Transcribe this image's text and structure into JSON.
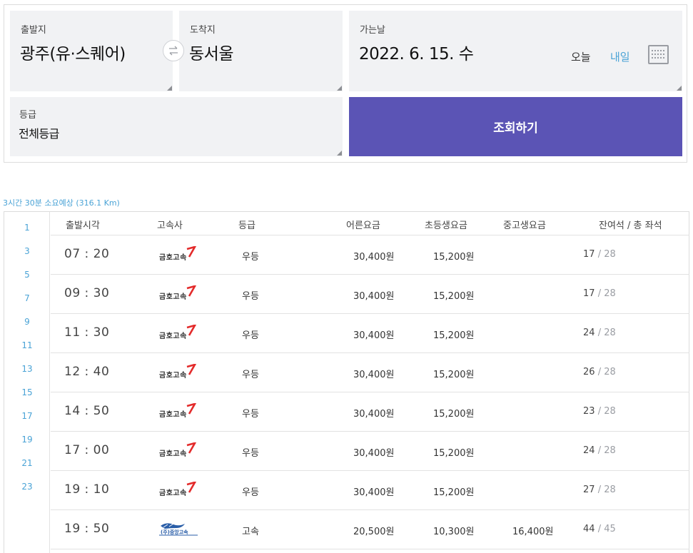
{
  "search": {
    "departure": {
      "label": "출발지",
      "value": "광주(유·스퀘어)"
    },
    "arrival": {
      "label": "도착지",
      "value": "동서울"
    },
    "date": {
      "label": "가는날",
      "value": "2022. 6. 15. 수",
      "today": "오늘",
      "tomorrow": "내일"
    },
    "grade": {
      "label": "등급",
      "value": "전체등급"
    },
    "search_button": "조회하기",
    "swap_icon": "swap-arrows-icon",
    "calendar_icon": "calendar-icon",
    "colors": {
      "search_button": "#5b54b5",
      "link": "#4aa3d6",
      "box": "#f1f2f4"
    }
  },
  "trip_info": "3시간 30분 소요예상 (316.1 Km)",
  "hours": [
    "1",
    "3",
    "5",
    "7",
    "9",
    "11",
    "13",
    "15",
    "17",
    "19",
    "21",
    "23"
  ],
  "table": {
    "headers": {
      "time": "출발시각",
      "company": "고속사",
      "grade": "등급",
      "adult": "어른요금",
      "child": "초등생요금",
      "student": "중고생요금",
      "seats": "잔여석 / 총 좌석"
    },
    "rows": [
      {
        "time": "07 : 20",
        "company": "금호고속",
        "grade": "우등",
        "adult": "30,400원",
        "child": "15,200원",
        "student": "",
        "remain": "17",
        "total": "/ 28"
      },
      {
        "time": "09 : 30",
        "company": "금호고속",
        "grade": "우등",
        "adult": "30,400원",
        "child": "15,200원",
        "student": "",
        "remain": "17",
        "total": "/ 28"
      },
      {
        "time": "11 : 30",
        "company": "금호고속",
        "grade": "우등",
        "adult": "30,400원",
        "child": "15,200원",
        "student": "",
        "remain": "24",
        "total": "/ 28"
      },
      {
        "time": "12 : 40",
        "company": "금호고속",
        "grade": "우등",
        "adult": "30,400원",
        "child": "15,200원",
        "student": "",
        "remain": "26",
        "total": "/ 28"
      },
      {
        "time": "14 : 50",
        "company": "금호고속",
        "grade": "우등",
        "adult": "30,400원",
        "child": "15,200원",
        "student": "",
        "remain": "23",
        "total": "/ 28"
      },
      {
        "time": "17 : 00",
        "company": "금호고속",
        "grade": "우등",
        "adult": "30,400원",
        "child": "15,200원",
        "student": "",
        "remain": "24",
        "total": "/ 28"
      },
      {
        "time": "19 : 10",
        "company": "금호고속",
        "grade": "우등",
        "adult": "30,400원",
        "child": "15,200원",
        "student": "",
        "remain": "27",
        "total": "/ 28"
      },
      {
        "time": "19 : 50",
        "company": "(주)중앙고속",
        "grade": "고속",
        "adult": "20,500원",
        "child": "10,300원",
        "student": "16,400원",
        "remain": "44",
        "total": "/ 45"
      }
    ]
  }
}
